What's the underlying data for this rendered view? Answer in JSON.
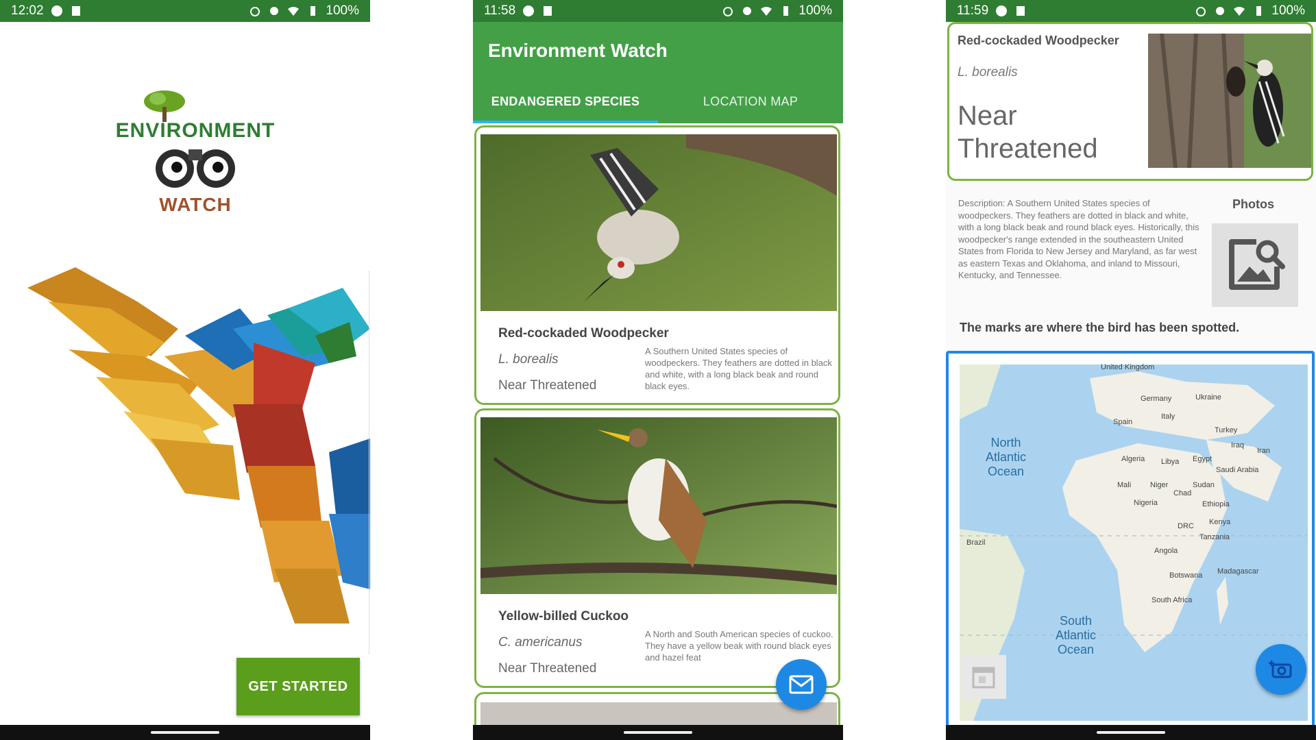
{
  "panel1": {
    "status": {
      "time": "12:02",
      "battery": "100%"
    },
    "logo": {
      "line1": "ENVIRONMENT",
      "line2": "WATCH"
    },
    "button_label": "GET STARTED"
  },
  "panel2": {
    "status": {
      "time": "11:58",
      "battery": "100%"
    },
    "app_title": "Environment Watch",
    "tabs": [
      {
        "label": "ENDANGERED SPECIES",
        "active": true
      },
      {
        "label": "LOCATION MAP",
        "active": false
      }
    ],
    "cards": [
      {
        "name": "Red-cockaded Woodpecker",
        "scientific": "L. borealis",
        "status": "Near Threatened",
        "description": "A Southern United States species of woodpeckers. They feathers are dotted in black and white, with a long black beak and round black eyes."
      },
      {
        "name": "Yellow-billed Cuckoo",
        "scientific": "C. americanus",
        "status": "Near Threatened",
        "description": "A North and South American species of cuckoo. They have a yellow beak with round black eyes and hazel feat"
      }
    ],
    "fab_icon": "email-icon"
  },
  "panel3": {
    "status": {
      "time": "11:59",
      "battery": "100%"
    },
    "name": "Red-cockaded Woodpecker",
    "scientific": "L. borealis",
    "status_text": "Near Threatened",
    "description": "Description: A Southern United States species of woodpeckers. They feathers are dotted in black and white, with a long black beak and round black eyes. Historically, this woodpecker's range extended in the southeastern United States from Florida to New Jersey and Maryland, as far west as eastern Texas and Oklahoma, and inland to Missouri, Kentucky, and Tennessee.",
    "photos_label": "Photos",
    "marks_text": "The marks are where the bird has been spotted.",
    "map": {
      "oceans": [
        {
          "name": "North Atlantic Ocean",
          "lines": [
            "North",
            "Atlantic",
            "Ocean"
          ]
        },
        {
          "name": "South Atlantic Ocean",
          "lines": [
            "South",
            "Atlantic",
            "Ocean"
          ]
        }
      ],
      "labels": [
        "United Kingdom",
        "Germany",
        "Ukraine",
        "Italy",
        "Spain",
        "Turkey",
        "Iraq",
        "Iran",
        "Algeria",
        "Libya",
        "Egypt",
        "Saudi Arabia",
        "Mali",
        "Niger",
        "Chad",
        "Sudan",
        "Nigeria",
        "Ethiopia",
        "DRC",
        "Kenya",
        "Tanzania",
        "Brazil",
        "Angola",
        "Botswana",
        "Madagascar",
        "South Africa"
      ]
    }
  },
  "colors": {
    "appbar": "#43a047",
    "statusbar": "#2e7d32",
    "card_border": "#7cb342",
    "fab": "#1e88e5",
    "start_button": "#5a9e1c"
  }
}
